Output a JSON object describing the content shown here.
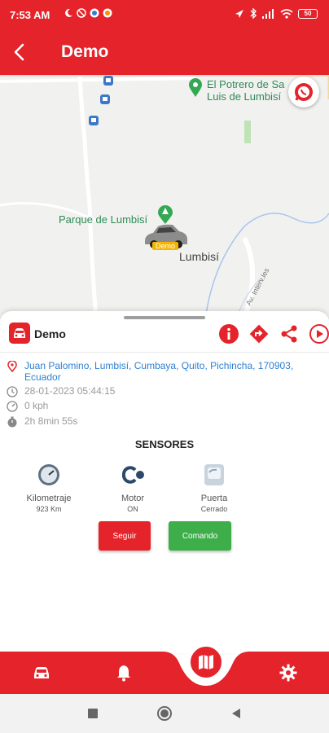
{
  "status_bar": {
    "time": "7:53 AM",
    "battery": "50"
  },
  "app_bar": {
    "title": "Demo"
  },
  "map": {
    "poi_top": "El Potrero de San Luis de Lumbisí",
    "poi_top_line1": "El Potrero de Sa",
    "poi_top_line2": "Luis de Lumbisí",
    "park": "Parque de Lumbisí",
    "place": "Lumbisí",
    "road": "Av. Interv.les",
    "car_tag": "Demo"
  },
  "device": {
    "name": "Demo",
    "address": "Juan Palomino, Lumbisí, Cumbaya, Quito, Pichincha, 170903, Ecuador",
    "datetime": "28-01-2023 05:44:15",
    "speed": "0 kph",
    "duration": "2h 8min 55s"
  },
  "sensors": {
    "title": "SENSORES",
    "items": [
      {
        "name": "Kilometraje",
        "value": "923 Km",
        "icon": "odometer-icon"
      },
      {
        "name": "Motor",
        "value": "ON",
        "icon": "engine-icon"
      },
      {
        "name": "Puerta",
        "value": "Cerrado",
        "icon": "door-icon"
      }
    ]
  },
  "buttons": {
    "follow": "Seguir",
    "command": "Comando"
  },
  "bottom_nav": {
    "items": [
      "car-icon",
      "bell-icon",
      "map-icon",
      "gear-icon"
    ]
  },
  "colors": {
    "primary": "#e4232a",
    "green": "#3dae4a",
    "link": "#2f80d1"
  }
}
